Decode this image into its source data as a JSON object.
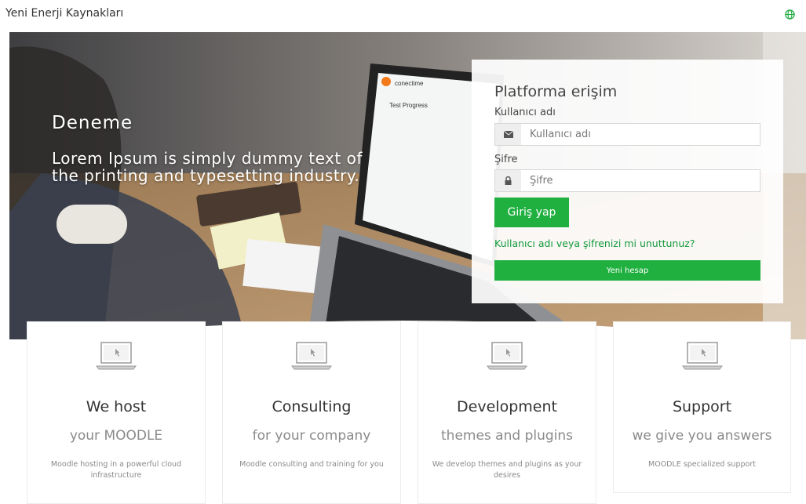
{
  "header": {
    "site_title": "Yeni Enerji Kaynakları",
    "language_icon": "globe-icon"
  },
  "hero": {
    "heading": "Deneme",
    "lead": "Lorem Ipsum is simply dummy text of the printing and typesetting industry.",
    "screen_brand": "conectime",
    "screen_title": "Test Progress"
  },
  "login": {
    "title": "Platforma erişim",
    "username_label": "Kullanıcı adı",
    "username_placeholder": "Kullanıcı adı",
    "username_icon": "envelope-icon",
    "password_label": "Şifre",
    "password_placeholder": "Şifre",
    "password_icon": "lock-icon",
    "login_button": "Giriş yap",
    "forgot_link": "Kullanıcı adı veya şifrenizi mi unuttunuz?",
    "new_account_button": "Yeni hesap"
  },
  "cards": [
    {
      "title": "We host",
      "subtitle": "your MOODLE",
      "description": "Moodle hosting in a powerful cloud infrastructure",
      "icon": "laptop-icon"
    },
    {
      "title": "Consulting",
      "subtitle": "for your company",
      "description": "Moodle consulting and training for you",
      "icon": "laptop-icon"
    },
    {
      "title": "Development",
      "subtitle": "themes and plugins",
      "description": "We develop themes and plugins as your desires",
      "icon": "laptop-icon"
    },
    {
      "title": "Support",
      "subtitle": "we give you answers",
      "description": "MOODLE specialized support",
      "icon": "laptop-icon"
    }
  ],
  "colors": {
    "accent": "#20b040",
    "link": "#129a3a"
  }
}
